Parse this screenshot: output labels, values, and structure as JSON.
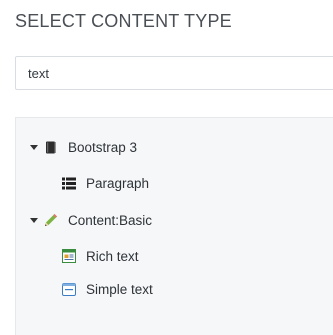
{
  "dialog": {
    "heading": "SELECT CONTENT TYPE"
  },
  "search": {
    "value": "text",
    "placeholder": ""
  },
  "tree": {
    "groups": [
      {
        "label": "Bootstrap 3",
        "icon": "book-icon",
        "expanded": true,
        "items": [
          {
            "label": "Paragraph",
            "icon": "paragraph-icon"
          }
        ]
      },
      {
        "label": "Content:Basic",
        "icon": "pencil-icon",
        "expanded": true,
        "items": [
          {
            "label": "Rich text",
            "icon": "rich-text-icon"
          },
          {
            "label": "Simple text",
            "icon": "simple-text-icon"
          }
        ]
      }
    ]
  },
  "colors": {
    "tree_background": "#f5f7f9",
    "pencil_green": "#6aa12b",
    "rich_text_green": "#3a8c3f",
    "simple_text_blue": "#3b7dc4"
  }
}
